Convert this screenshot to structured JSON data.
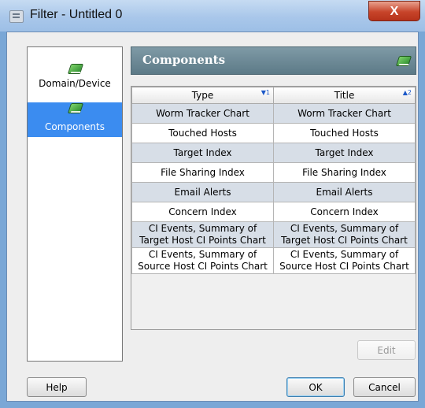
{
  "window": {
    "title": "Filter - Untitled 0",
    "close_label": "X"
  },
  "nav": {
    "items": [
      {
        "label": "Domain/Device",
        "icon": "green-book-icon",
        "selected": false
      },
      {
        "label": "Components",
        "icon": "green-book-icon",
        "selected": true
      }
    ]
  },
  "panel": {
    "title": "Components",
    "icon": "green-book-icon"
  },
  "table": {
    "columns": [
      {
        "label": "Type",
        "sort": "▼1"
      },
      {
        "label": "Title",
        "sort": "▲2"
      }
    ],
    "rows": [
      [
        "Worm Tracker Chart",
        "Worm Tracker Chart"
      ],
      [
        "Touched Hosts",
        "Touched Hosts"
      ],
      [
        "Target Index",
        "Target Index"
      ],
      [
        "File Sharing Index",
        "File Sharing Index"
      ],
      [
        "Email Alerts",
        "Email Alerts"
      ],
      [
        "Concern Index",
        "Concern Index"
      ],
      [
        "CI Events, Summary of Target Host CI Points Chart",
        "CI Events, Summary of Target Host CI Points Chart"
      ],
      [
        "CI Events, Summary of Source Host CI Points Chart",
        "CI Events, Summary of Source Host CI Points Chart"
      ]
    ]
  },
  "buttons": {
    "edit": "Edit",
    "help": "Help",
    "ok": "OK",
    "cancel": "Cancel"
  },
  "colors": {
    "selection": "#3b8cf0",
    "header_bar": "#6a8692",
    "row_shade": "#d7dee7"
  }
}
